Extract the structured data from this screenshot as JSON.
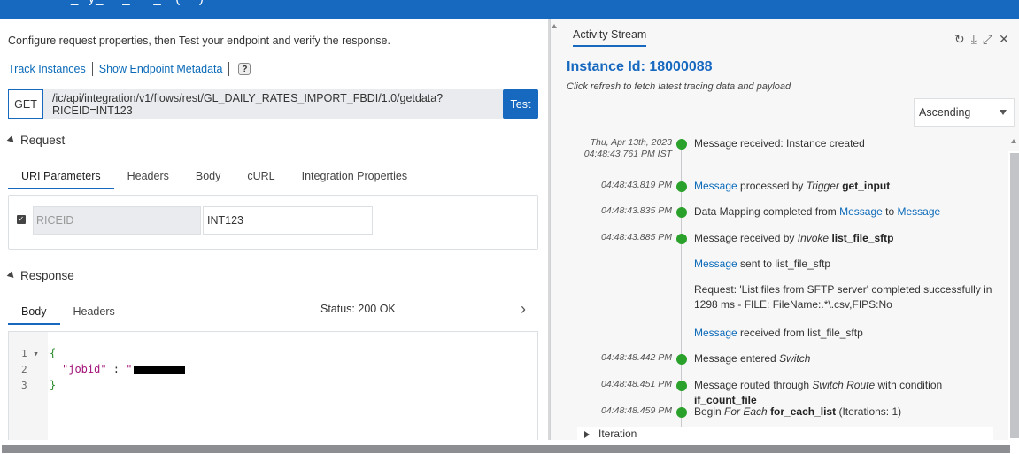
{
  "left": {
    "intro": "Configure request properties, then Test your endpoint and verify the response.",
    "links": {
      "track_instances": "Track Instances",
      "show_metadata": "Show Endpoint Metadata",
      "help": "?"
    },
    "request": {
      "method": "GET",
      "url": "/ic/api/integration/v1/flows/rest/GL_DAILY_RATES_IMPORT_FBDI/1.0/getdata?RICEID=INT123",
      "test_label": "Test",
      "section_label": "Request",
      "tabs": [
        "URI Parameters",
        "Headers",
        "Body",
        "cURL",
        "Integration Properties"
      ],
      "param": {
        "name": "RICEID",
        "value": "INT123"
      }
    },
    "response": {
      "section_label": "Response",
      "tabs": [
        "Body",
        "Headers"
      ],
      "status": "Status: 200 OK",
      "code": {
        "line_numbers": [
          "1",
          "2",
          "3"
        ],
        "fold_marker": "▾",
        "open_brace": "{",
        "key": "\"jobid\"",
        "colon": " : ",
        "value_prefix": "\"",
        "close_brace": "}"
      }
    }
  },
  "right": {
    "title": "Activity Stream",
    "icons": [
      "refresh-icon",
      "download-icon",
      "expand-icon",
      "close-icon"
    ],
    "instance": "Instance Id: 18000088",
    "refresh_note": "Click refresh to fetch latest tracing data and payload",
    "sort": "Ascending",
    "events": [
      {
        "time": "Thu, Apr 13th, 2023\n04:48:43.761 PM IST",
        "parts": [
          [
            "t",
            "Message received: Instance created"
          ]
        ]
      },
      {
        "time": "04:48:43.819 PM",
        "parts": [
          [
            "a",
            "Message"
          ],
          [
            "t",
            " processed by "
          ],
          [
            "i",
            "Trigger"
          ],
          [
            "t",
            " "
          ],
          [
            "b",
            "get_input"
          ]
        ]
      },
      {
        "time": "04:48:43.835 PM",
        "parts": [
          [
            "t",
            "Data Mapping completed from "
          ],
          [
            "a",
            "Message"
          ],
          [
            "t",
            " to "
          ],
          [
            "a",
            "Message"
          ]
        ]
      },
      {
        "time": "04:48:43.885 PM",
        "parts": [
          [
            "t",
            "Message received by "
          ],
          [
            "i",
            "Invoke"
          ],
          [
            "t",
            " "
          ],
          [
            "b",
            "list_file_sftp"
          ]
        ]
      },
      {
        "time": "",
        "parts": [
          [
            "a",
            "Message"
          ],
          [
            "t",
            " sent to list_file_sftp"
          ]
        ]
      },
      {
        "time": "",
        "parts": [
          [
            "t",
            "Request: 'List files from SFTP server' completed successfully in 1298 ms - FILE: FileName:.*\\.csv,FIPS:No"
          ]
        ]
      },
      {
        "time": "",
        "parts": [
          [
            "a",
            "Message"
          ],
          [
            "t",
            " received from list_file_sftp"
          ]
        ]
      },
      {
        "time": "04:48:48.442 PM",
        "parts": [
          [
            "t",
            "Message entered "
          ],
          [
            "i",
            "Switch"
          ]
        ]
      },
      {
        "time": "04:48:48.451 PM",
        "parts": [
          [
            "t",
            "Message routed through "
          ],
          [
            "i",
            "Switch Route"
          ],
          [
            "t",
            " with condition "
          ],
          [
            "b",
            "if_count_file"
          ]
        ]
      },
      {
        "time": "04:48:48.459 PM",
        "parts": [
          [
            "t",
            "Begin "
          ],
          [
            "i",
            "For Each"
          ],
          [
            "t",
            " "
          ],
          [
            "b",
            "for_each_list"
          ],
          [
            "t",
            " (Iterations: 1)"
          ]
        ]
      }
    ],
    "iteration_label": "Iteration"
  }
}
